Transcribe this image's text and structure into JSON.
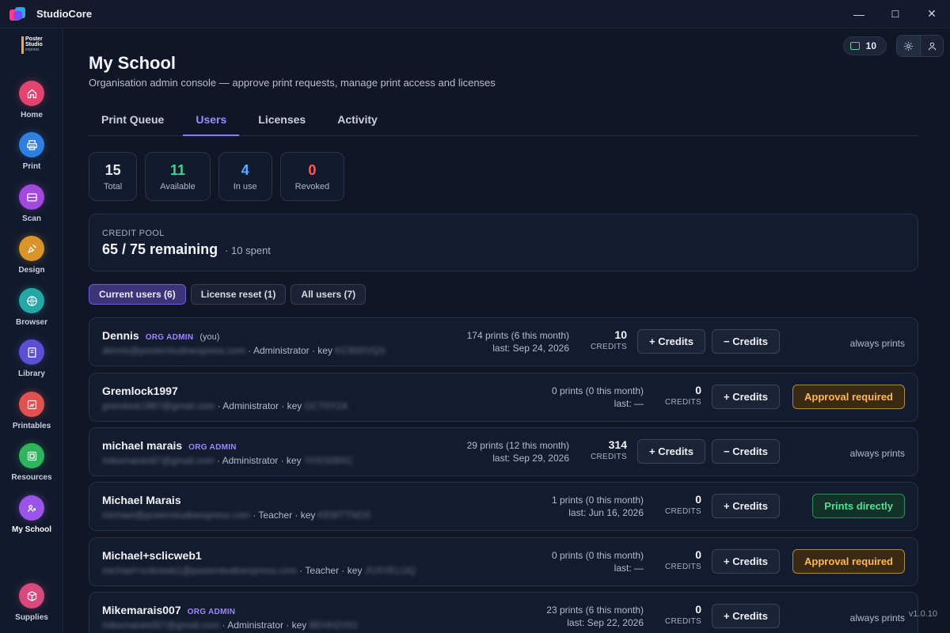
{
  "app": {
    "title": "StudioCore"
  },
  "window_controls": {
    "minimize": "—",
    "maximize": "☐",
    "close": "✕"
  },
  "brand": {
    "line1": "Poster",
    "line2": "Studio",
    "line3": "express"
  },
  "sidebar": {
    "items": [
      {
        "label": "Home",
        "icon": "home-icon",
        "color": "#e0446f"
      },
      {
        "label": "Print",
        "icon": "printer-icon",
        "color": "#2f7fe0"
      },
      {
        "label": "Scan",
        "icon": "scanner-icon",
        "color": "#a349e0"
      },
      {
        "label": "Design",
        "icon": "design-icon",
        "color": "#d9952a"
      },
      {
        "label": "Browser",
        "icon": "globe-icon",
        "color": "#23a8a8"
      },
      {
        "label": "Library",
        "icon": "book-icon",
        "color": "#5b4fd6"
      },
      {
        "label": "Printables",
        "icon": "printables-icon",
        "color": "#e0524f"
      },
      {
        "label": "Resources",
        "icon": "resources-icon",
        "color": "#2fb55e"
      },
      {
        "label": "My School",
        "icon": "school-icon",
        "color": "#9a55e8"
      },
      {
        "label": "Supplies",
        "icon": "supplies-icon",
        "color": "#d94a7c"
      }
    ]
  },
  "header": {
    "credit_count": "10"
  },
  "page": {
    "title": "My School",
    "subtitle": "Organisation admin console — approve print requests, manage print access and licenses"
  },
  "tabs": [
    {
      "label": "Print Queue",
      "active": false
    },
    {
      "label": "Users",
      "active": true
    },
    {
      "label": "Licenses",
      "active": false
    },
    {
      "label": "Activity",
      "active": false
    }
  ],
  "stats": [
    {
      "value": "15",
      "label": "Total",
      "color": "#f3f5fa"
    },
    {
      "value": "11",
      "label": "Available",
      "color": "#3ed58a"
    },
    {
      "value": "4",
      "label": "In use",
      "color": "#4fb0ff"
    },
    {
      "value": "0",
      "label": "Revoked",
      "color": "#ff5a5a"
    }
  ],
  "pool": {
    "label": "CREDIT POOL",
    "main": "65 / 75 remaining",
    "spent": "· 10 spent"
  },
  "filters": [
    {
      "label": "Current users (6)",
      "active": true
    },
    {
      "label": "License reset (1)",
      "active": false
    },
    {
      "label": "All users (7)",
      "active": false
    }
  ],
  "users": [
    {
      "name": "Dennis",
      "badge": "ORG ADMIN",
      "you": "(you)",
      "email": "dennis@posterstudioexpress.com",
      "role_text": "· Administrator · key",
      "key": "KC9S0VQS",
      "prints": "174 prints (6 this month)",
      "last": "last: Sep 24, 2026",
      "credits": "10",
      "credits_label": "CREDITS",
      "add_label": "+ Credits",
      "remove_label": "− Credits",
      "status": "always prints",
      "status_type": "text"
    },
    {
      "name": "Gremlock1997",
      "badge": "",
      "you": "",
      "email": "gremlock1997@gmail.com",
      "role_text": "· Administrator · key",
      "key": "OCT5Y2A",
      "prints": "0 prints (0 this month)",
      "last": "last: —",
      "credits": "0",
      "credits_label": "CREDITS",
      "add_label": "+ Credits",
      "remove_label": "",
      "status": "Approval required",
      "status_type": "approval"
    },
    {
      "name": "michael marais",
      "badge": "ORG ADMIN",
      "you": "",
      "email": "mikemarais97@gmail.com",
      "role_text": "· Administrator · key",
      "key": "YHXS09XC",
      "prints": "29 prints (12 this month)",
      "last": "last: Sep 29, 2026",
      "credits": "314",
      "credits_label": "CREDITS",
      "add_label": "+ Credits",
      "remove_label": "− Credits",
      "status": "always prints",
      "status_type": "text"
    },
    {
      "name": "Michael Marais",
      "badge": "",
      "you": "",
      "email": "michael@posterstudioexpress.com",
      "role_text": "· Teacher · key",
      "key": "KEMTTNOS",
      "prints": "1 prints (0 this month)",
      "last": "last: Jun 16, 2026",
      "credits": "0",
      "credits_label": "CREDITS",
      "add_label": "+ Credits",
      "remove_label": "",
      "status": "Prints directly",
      "status_type": "direct"
    },
    {
      "name": "Michael+sclicweb1",
      "badge": "",
      "you": "",
      "email": "michael+sclicweb1@posterstudioexpress.com",
      "role_text": "· Teacher · key",
      "key": "JUXVELOQ",
      "prints": "0 prints (0 this month)",
      "last": "last: —",
      "credits": "0",
      "credits_label": "CREDITS",
      "add_label": "+ Credits",
      "remove_label": "",
      "status": "Approval required",
      "status_type": "approval"
    },
    {
      "name": "Mikemarais007",
      "badge": "ORG ADMIN",
      "you": "",
      "email": "mikemarais007@gmail.com",
      "role_text": "· Administrator · key",
      "key": "BEHH2VIO",
      "prints": "23 prints (6 this month)",
      "last": "last: Sep 22, 2026",
      "credits": "0",
      "credits_label": "CREDITS",
      "add_label": "+ Credits",
      "remove_label": "",
      "status": "always prints",
      "status_type": "text"
    }
  ],
  "version": "v1.0.10"
}
